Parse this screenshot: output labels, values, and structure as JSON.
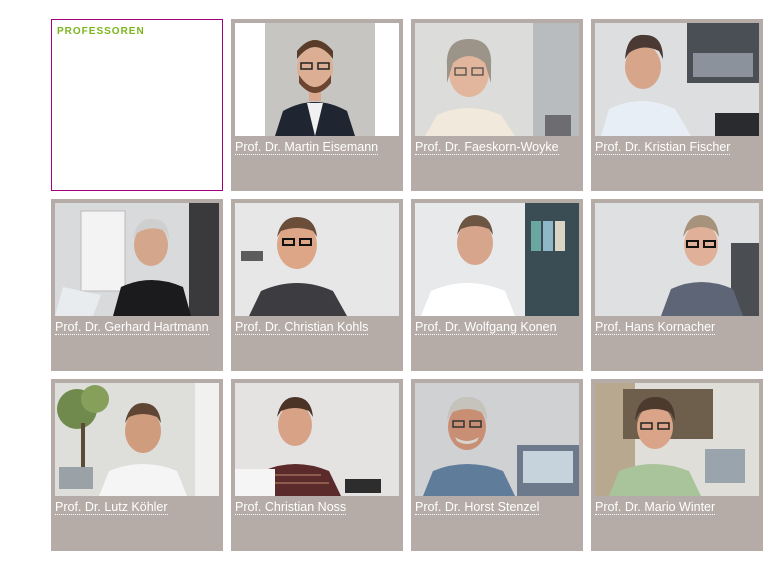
{
  "section": {
    "title": "PROFESSOREN"
  },
  "professors": [
    {
      "name": "Prof. Dr. Martin Eisemann",
      "photo": "portrait-martin-eisemann"
    },
    {
      "name": "Prof. Dr. Faeskorn-Woyke",
      "photo": "portrait-faeskorn-woyke"
    },
    {
      "name": "Prof. Dr. Kristian Fischer",
      "photo": "portrait-kristian-fischer"
    },
    {
      "name": "Prof. Dr. Gerhard Hartmann",
      "photo": "portrait-gerhard-hartmann"
    },
    {
      "name": "Prof. Dr. Christian Kohls",
      "photo": "portrait-christian-kohls"
    },
    {
      "name": "Prof. Dr. Wolfgang Konen",
      "photo": "portrait-wolfgang-konen"
    },
    {
      "name": "Prof. Hans Kornacher",
      "photo": "portrait-hans-kornacher"
    },
    {
      "name": "Prof. Dr. Lutz Köhler",
      "photo": "portrait-lutz-koehler"
    },
    {
      "name": "Prof. Christian Noss",
      "photo": "portrait-christian-noss"
    },
    {
      "name": "Prof. Dr. Horst Stenzel",
      "photo": "portrait-horst-stenzel"
    },
    {
      "name": "Prof. Dr. Mario Winter",
      "photo": "portrait-mario-winter"
    }
  ],
  "colors": {
    "tile_bg": "#b5aca7",
    "header_border": "#a5007c",
    "header_title": "#7ab51d",
    "name_text": "#ffffff"
  }
}
